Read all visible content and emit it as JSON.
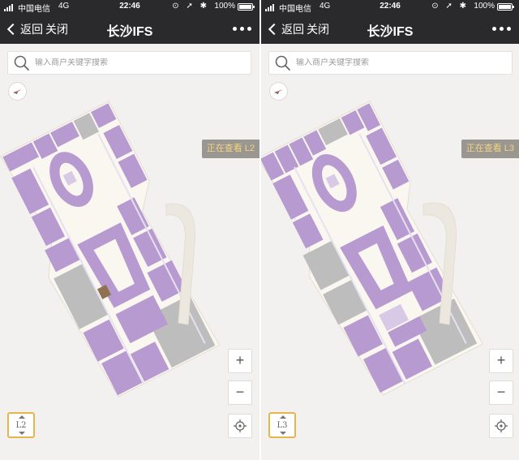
{
  "colors": {
    "nav_bg": "#2a2a2c",
    "map_bg": "#f2f1ef",
    "shop": "#b79ad0",
    "shop_highlight": "#d8c9e6",
    "anchor_store": "#bdbdbd",
    "corridor": "#faf7f0",
    "accent_gold": "#e6b54d",
    "badge_bg": "#9a9792",
    "badge_text": "#f3d37c",
    "selected_unit": "#8f7350"
  },
  "screens": [
    {
      "status": {
        "carrier": "中国电信",
        "network": "4G",
        "time": "22:46",
        "battery": "100%",
        "icons": "⊙ ➚ ✱"
      },
      "nav": {
        "back_label": "返回",
        "close_label": "关闭",
        "title": "长沙IFS",
        "more_icon": "ellipsis-icon"
      },
      "search": {
        "placeholder": "输入商户关键字搜索",
        "value": ""
      },
      "floor": {
        "viewing_label": "正在查看 L2",
        "current": "L2"
      },
      "controls": {
        "zoom_in": "+",
        "zoom_out": "−"
      }
    },
    {
      "status": {
        "carrier": "中国电信",
        "network": "4G",
        "time": "22:46",
        "battery": "100%",
        "icons": "⊙ ➚ ✱"
      },
      "nav": {
        "back_label": "返回",
        "close_label": "关闭",
        "title": "长沙IFS",
        "more_icon": "ellipsis-icon"
      },
      "search": {
        "placeholder": "输入商户关键字搜索",
        "value": ""
      },
      "floor": {
        "viewing_label": "正在查看 L3",
        "current": "L3"
      },
      "controls": {
        "zoom_in": "+",
        "zoom_out": "−"
      }
    }
  ]
}
